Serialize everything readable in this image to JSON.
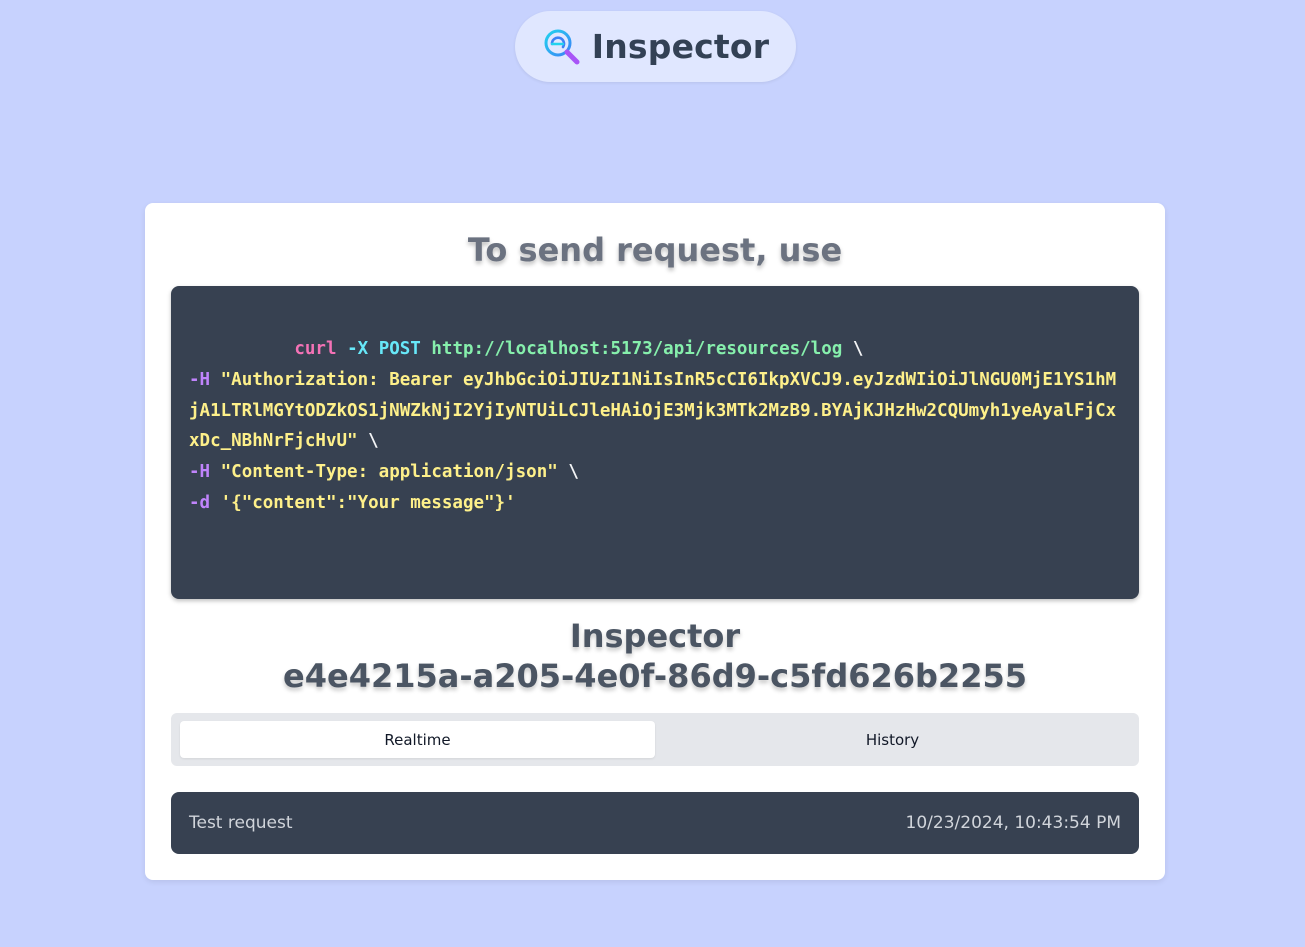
{
  "header": {
    "app_name": "Inspector",
    "logo_icon": "magnifier-logo-icon"
  },
  "send_section": {
    "title": "To send request, use",
    "code": {
      "cmd": "curl",
      "flag_x": "-X",
      "method": "POST",
      "url": "http://localhost:5173/api/resources/log",
      "continuation": "\\",
      "flag_h": "-H",
      "auth_header": "\"Authorization: Bearer eyJhbGciOiJIUzI1NiIsInR5cCI6IkpXVCJ9.eyJzdWIiOiJlNGU0MjE1YS1hMjA1LTRlMGYtODZkOS1jNWZkNjI2YjIyNTUiLCJleHAiOjE3Mjk3MTk2MzB9.BYAjKJHzHw2CQUmyh1yeAyalFjCxxDc_NBhNrFjcHvU\"",
      "content_type_header": "\"Content-Type: application/json\"",
      "flag_d": "-d",
      "body": "'{\"content\":\"Your message\"}'"
    }
  },
  "inspector": {
    "label": "Inspector",
    "id": "e4e4215a-a205-4e0f-86d9-c5fd626b2255"
  },
  "tabs": {
    "realtime": "Realtime",
    "history": "History",
    "active": "Realtime"
  },
  "requests": [
    {
      "label": "Test request",
      "timestamp": "10/23/2024, 10:43:54 PM"
    }
  ],
  "colors": {
    "page_bg": "#c7d2fe",
    "card_bg": "#ffffff",
    "code_bg": "#374151",
    "pill_bg": "#e0e7ff"
  }
}
